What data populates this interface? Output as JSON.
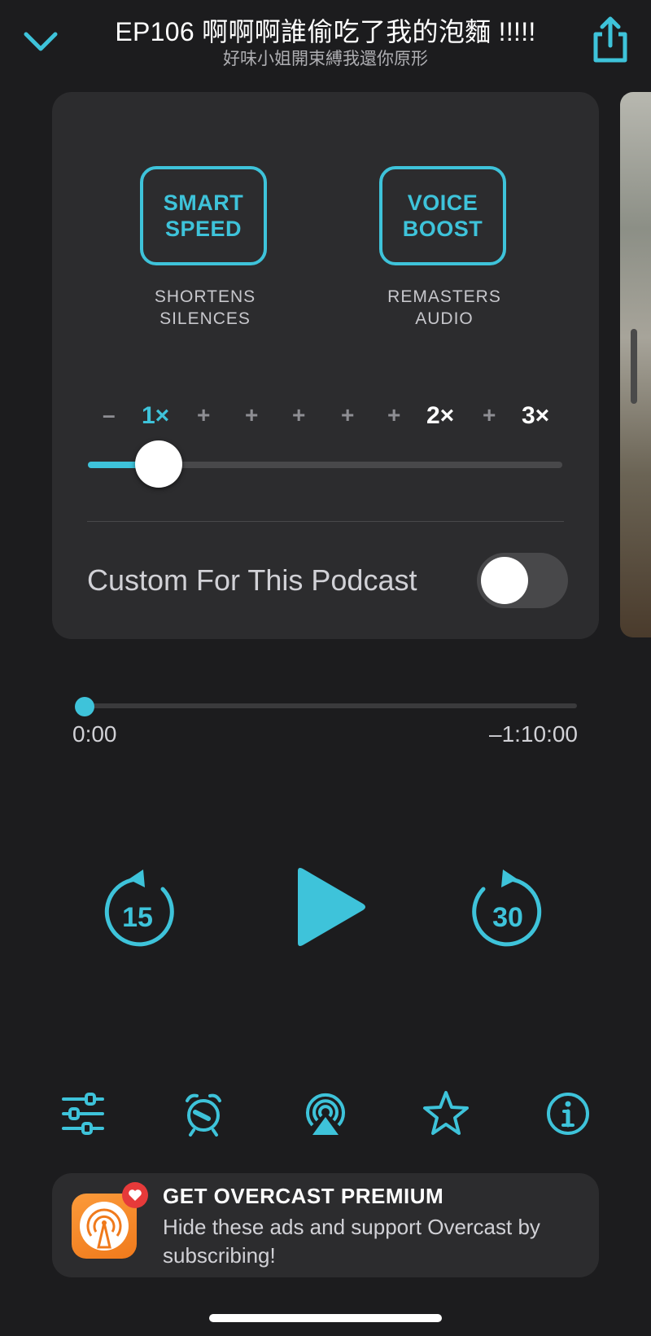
{
  "header": {
    "title": "EP106 啊啊啊誰偷吃了我的泡麵 !!!!!",
    "subtitle": "好味小姐開束縛我還你原形",
    "collapse_icon": "chevron-down-icon",
    "share_icon": "share-icon"
  },
  "effects": {
    "smart_speed": {
      "line1": "SMART",
      "line2": "SPEED",
      "desc1": "SHORTENS",
      "desc2": "SILENCES"
    },
    "voice_boost": {
      "line1": "VOICE",
      "line2": "BOOST",
      "desc1": "REMASTERS",
      "desc2": "AUDIO"
    }
  },
  "speed": {
    "ticks": [
      "–",
      "1×",
      "+",
      "+",
      "+",
      "+",
      "+",
      "2×",
      "+",
      "3×"
    ],
    "selected": "1×"
  },
  "custom_podcast": {
    "label": "Custom For This Podcast",
    "enabled": false
  },
  "progress": {
    "elapsed": "0:00",
    "remaining": "–1:10:00",
    "fraction": 0
  },
  "controls": {
    "skip_back": "15",
    "skip_forward": "30"
  },
  "toolbar": [
    "equalizer-sliders-icon",
    "alarm-clock-icon",
    "airplay-icon",
    "star-icon",
    "info-icon"
  ],
  "banner": {
    "title": "GET OVERCAST PREMIUM",
    "text": "Hide these ads and support Overcast by subscribing!"
  },
  "colors": {
    "accent": "#3ec3da",
    "background": "#1c1c1e",
    "card": "#2c2c2e"
  }
}
